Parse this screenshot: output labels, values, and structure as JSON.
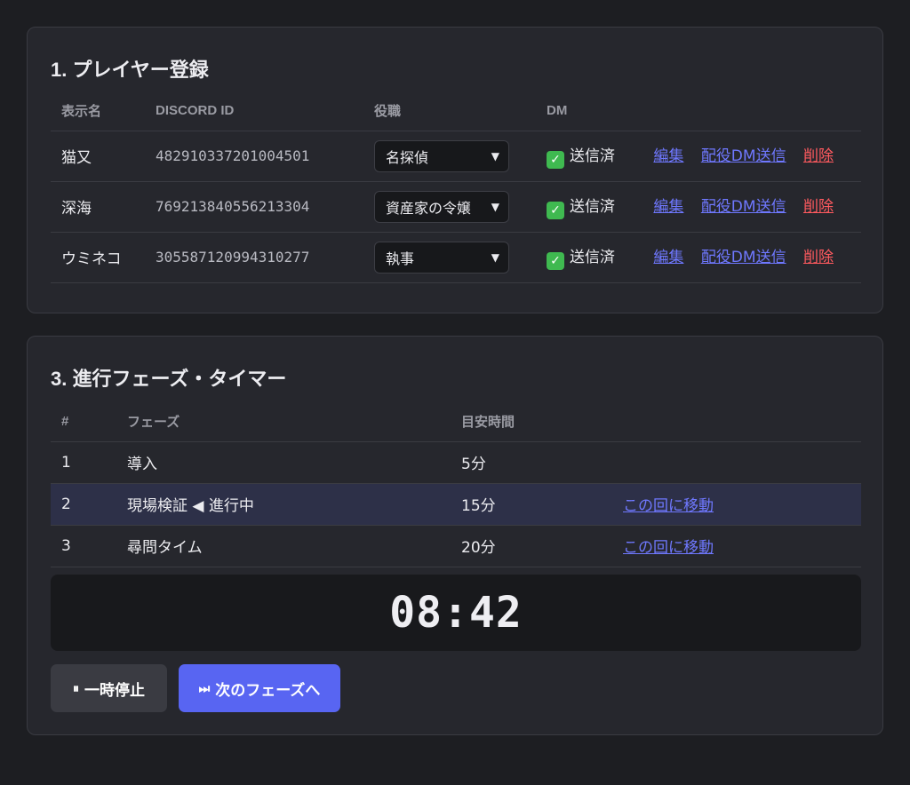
{
  "players_section": {
    "title": "1. プレイヤー登録",
    "columns": [
      "表示名",
      "DISCORD ID",
      "役職",
      "DM"
    ],
    "rows": [
      {
        "name": "猫又",
        "discord_id": "482910337201004501",
        "role": "名探偵",
        "dm_status": "送信済"
      },
      {
        "name": "深海",
        "discord_id": "769213840556213304",
        "role": "資産家の令嬢",
        "dm_status": "送信済"
      },
      {
        "name": "ウミネコ",
        "discord_id": "305587120994310277",
        "role": "執事",
        "dm_status": "送信済"
      }
    ],
    "actions": {
      "edit": "編集",
      "send_dm": "配役DM送信",
      "delete": "削除"
    }
  },
  "phases_section": {
    "title": "3. 進行フェーズ・タイマー",
    "columns": [
      "#",
      "フェーズ",
      "目安時間"
    ],
    "rows": [
      {
        "num": "1",
        "name": "導入",
        "time": "5分",
        "move_label": ""
      },
      {
        "num": "2",
        "name": "現場検証 ◀ 進行中",
        "time": "15分",
        "move_label": "この回に移動"
      },
      {
        "num": "3",
        "name": "尋問タイム",
        "time": "20分",
        "move_label": "この回に移動"
      }
    ],
    "timer": "08:42",
    "pause_label": "一時停止",
    "next_label": "次のフェーズへ"
  },
  "colors": {
    "accent": "#5865f2",
    "link": "#6f78ff",
    "danger": "#ff5a5f",
    "success": "#3fb950"
  }
}
